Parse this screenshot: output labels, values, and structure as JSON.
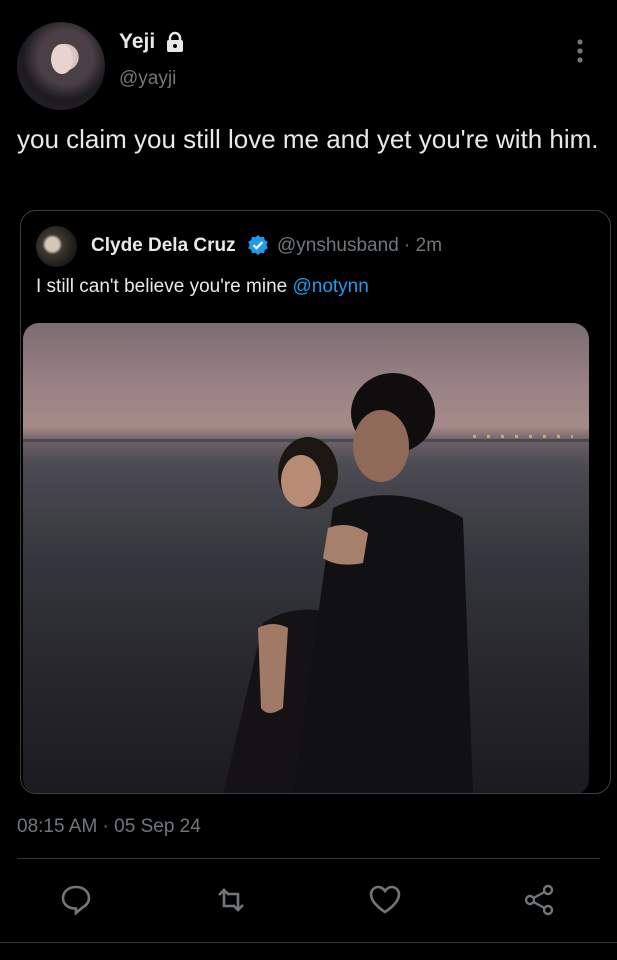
{
  "author": {
    "name": "Yeji",
    "handle": "@yayji"
  },
  "tweet": {
    "text": "you claim you still love me and yet you're with him."
  },
  "quote": {
    "name": "Clyde Dela Cruz",
    "handle_time": "@ynshusband · 2m",
    "text": "I still can't believe you're mine ",
    "mention": "@notynn"
  },
  "timestamp": "08:15 AM · 05 Sep 24",
  "icons": {
    "lock": "lock-icon",
    "more": "more-vertical-icon",
    "verified": "verified-badge-icon",
    "reply": "reply-icon",
    "retweet": "retweet-icon",
    "like": "like-icon",
    "share": "share-icon"
  },
  "colors": {
    "accent": "#1d9bf0",
    "muted": "#71767b",
    "text": "#e7e9ea",
    "background": "#000000"
  }
}
